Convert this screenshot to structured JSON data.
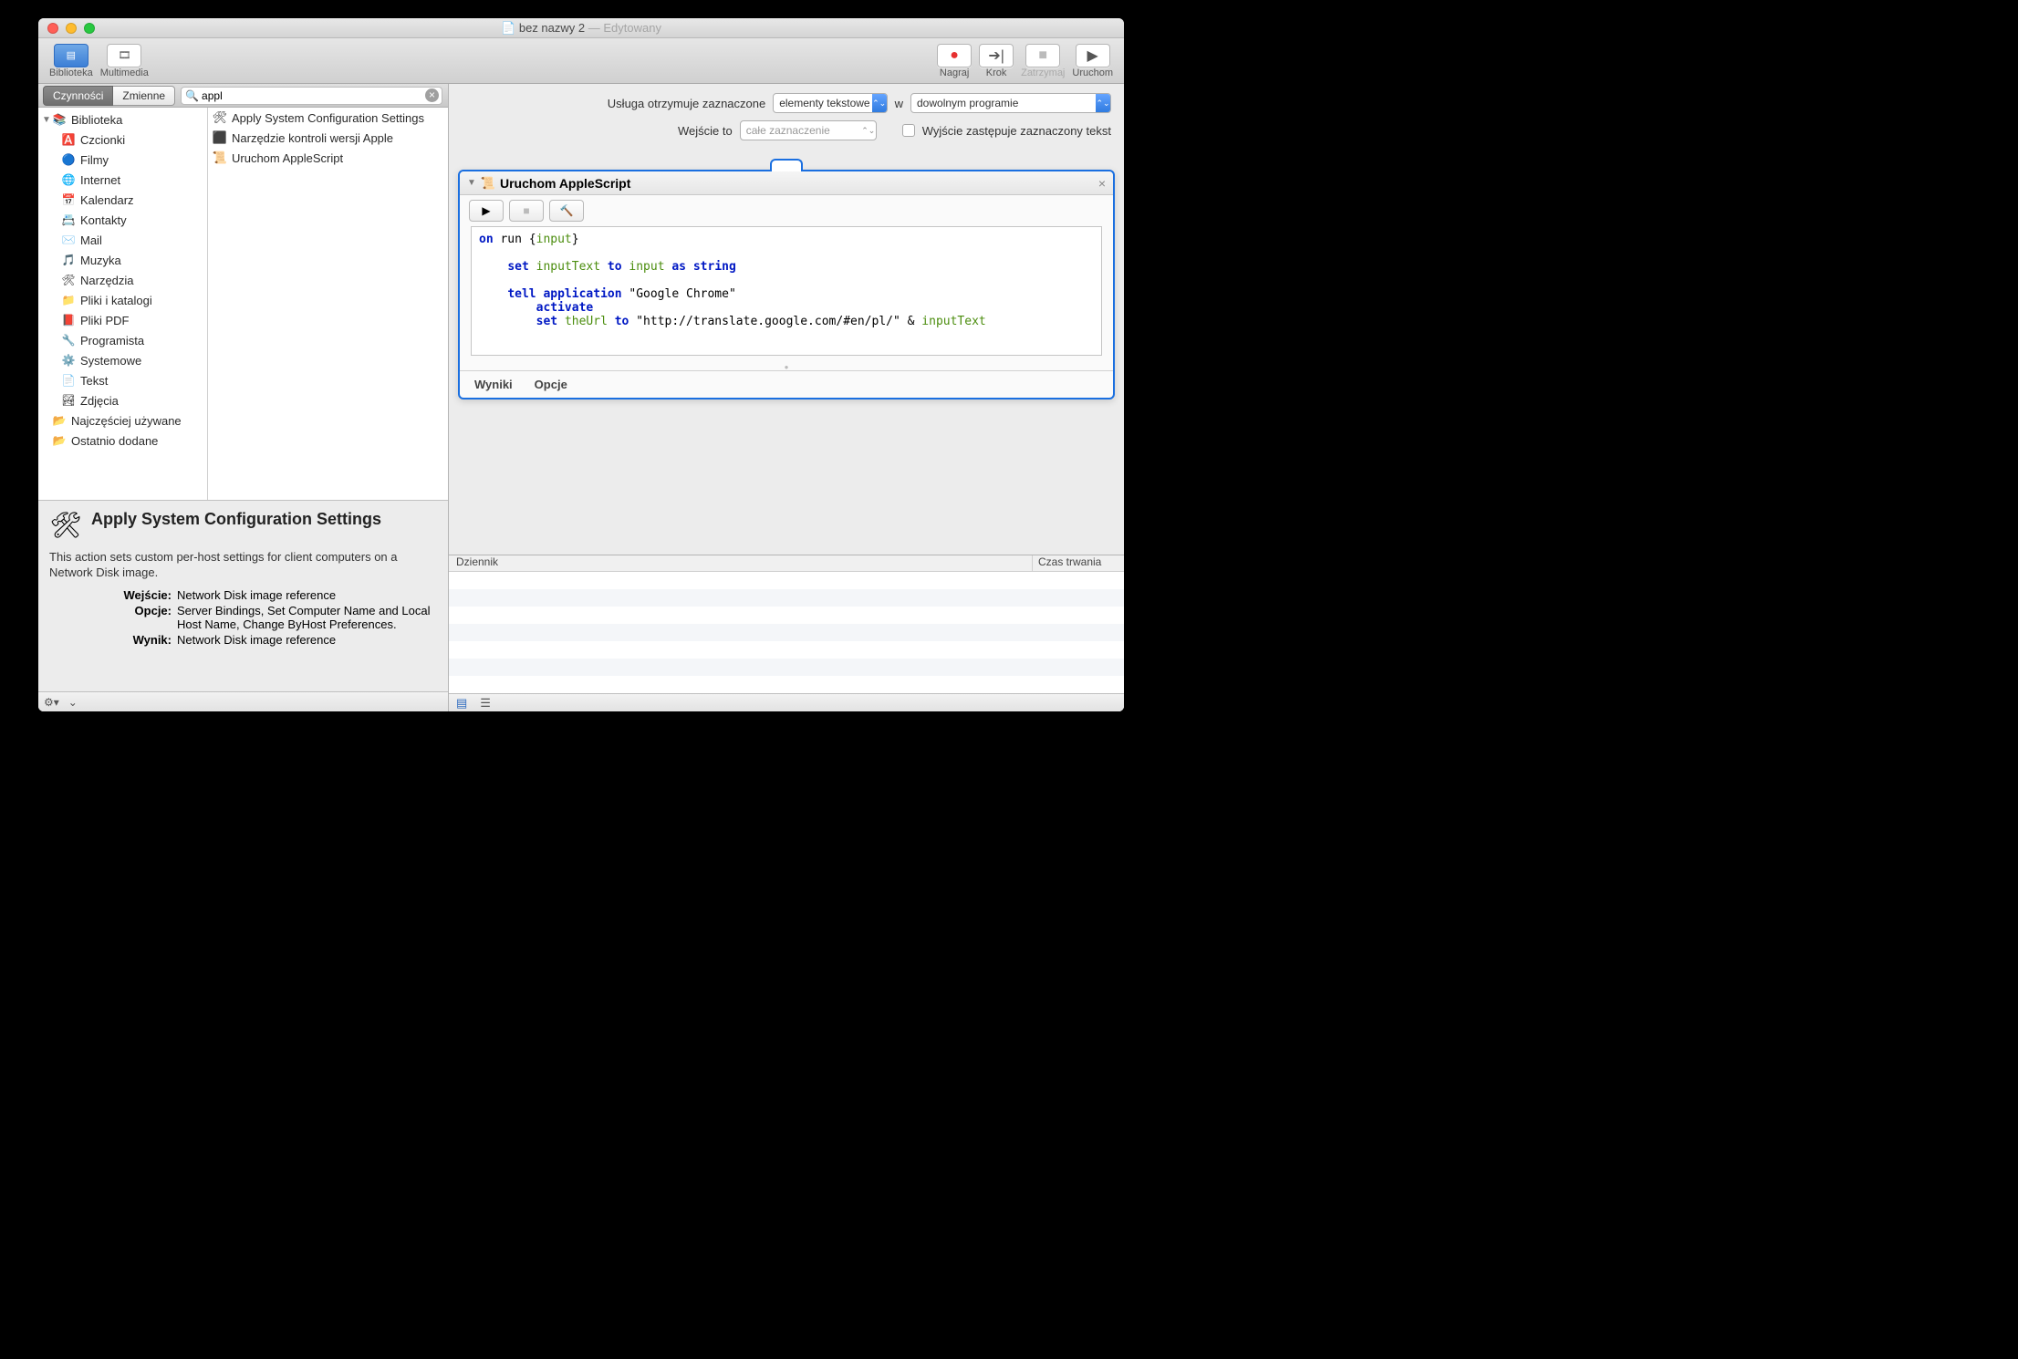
{
  "window": {
    "doc_icon": "📄",
    "title_main": "bez nazwy 2",
    "title_sep": " — ",
    "title_status": "Edytowany"
  },
  "toolbar": {
    "left": [
      {
        "name": "biblioteka",
        "label": "Biblioteka",
        "icon": "▤",
        "selected": true
      },
      {
        "name": "multimedia",
        "label": "Multimedia",
        "icon": "🎞",
        "selected": false
      }
    ],
    "right": [
      {
        "name": "nagraj",
        "label": "Nagraj",
        "icon": "●",
        "color": "#e63030"
      },
      {
        "name": "krok",
        "label": "Krok",
        "icon": "➔|",
        "color": "#555"
      },
      {
        "name": "zatrzymaj",
        "label": "Zatrzymaj",
        "icon": "■",
        "color": "#bbb",
        "disabled": true
      },
      {
        "name": "uruchom",
        "label": "Uruchom",
        "icon": "▶",
        "color": "#555"
      }
    ]
  },
  "library": {
    "tabs": {
      "actions": "Czynności",
      "variables": "Zmienne"
    },
    "search_value": "appl",
    "tree_root": "Biblioteka",
    "categories": [
      {
        "label": "Czcionki",
        "icon": "🅰️"
      },
      {
        "label": "Filmy",
        "icon": "🔵"
      },
      {
        "label": "Internet",
        "icon": "🌐"
      },
      {
        "label": "Kalendarz",
        "icon": "📅"
      },
      {
        "label": "Kontakty",
        "icon": "📇"
      },
      {
        "label": "Mail",
        "icon": "✉️"
      },
      {
        "label": "Muzyka",
        "icon": "🎵"
      },
      {
        "label": "Narzędzia",
        "icon": "🛠"
      },
      {
        "label": "Pliki i katalogi",
        "icon": "📁"
      },
      {
        "label": "Pliki PDF",
        "icon": "📕"
      },
      {
        "label": "Programista",
        "icon": "🔧"
      },
      {
        "label": "Systemowe",
        "icon": "⚙️"
      },
      {
        "label": "Tekst",
        "icon": "📄"
      },
      {
        "label": "Zdjęcia",
        "icon": "🏞"
      }
    ],
    "smart": [
      {
        "label": "Najczęściej używane",
        "icon": "📂"
      },
      {
        "label": "Ostatnio dodane",
        "icon": "📂"
      }
    ],
    "results": [
      {
        "label": "Apply System Configuration Settings",
        "icon": "🛠"
      },
      {
        "label": "Narzędzie kontroli wersji Apple",
        "icon": "⬛"
      },
      {
        "label": "Uruchom AppleScript",
        "icon": "📜"
      }
    ]
  },
  "info": {
    "title": "Apply System Configuration Settings",
    "desc": "This action sets custom per-host settings for client computers on a Network Disk image.",
    "rows": [
      {
        "label": "Wejście:",
        "value": "Network Disk image reference"
      },
      {
        "label": "Opcje:",
        "value": "Server Bindings, Set Computer Name and Local Host Name, Change ByHost Preferences."
      },
      {
        "label": "Wynik:",
        "value": "Network Disk image reference"
      }
    ]
  },
  "config": {
    "row1_label": "Usługa otrzymuje zaznaczone",
    "type_select": "elementy tekstowe",
    "in_label": "w",
    "app_select": "dowolnym programie",
    "row2_label": "Wejście to",
    "input_select": "całe zaznaczenie",
    "output_check_label": "Wyjście zastępuje zaznaczony tekst"
  },
  "action": {
    "title": "Uruchom AppleScript",
    "code_lines": [
      {
        "chunks": [
          {
            "t": "on",
            "c": "kw"
          },
          {
            "t": " run {",
            "c": ""
          },
          {
            "t": "input",
            "c": "var"
          },
          {
            "t": "}",
            "c": ""
          }
        ]
      },
      {
        "chunks": []
      },
      {
        "chunks": [
          {
            "t": "\t",
            "c": ""
          },
          {
            "t": "set",
            "c": "kw"
          },
          {
            "t": " ",
            "c": ""
          },
          {
            "t": "inputText",
            "c": "var"
          },
          {
            "t": " ",
            "c": ""
          },
          {
            "t": "to",
            "c": "kw"
          },
          {
            "t": " ",
            "c": ""
          },
          {
            "t": "input",
            "c": "var"
          },
          {
            "t": " ",
            "c": ""
          },
          {
            "t": "as",
            "c": "kw"
          },
          {
            "t": " ",
            "c": ""
          },
          {
            "t": "string",
            "c": "op"
          }
        ]
      },
      {
        "chunks": []
      },
      {
        "chunks": [
          {
            "t": "\t",
            "c": ""
          },
          {
            "t": "tell",
            "c": "kw"
          },
          {
            "t": " ",
            "c": ""
          },
          {
            "t": "application",
            "c": "op"
          },
          {
            "t": " \"Google Chrome\"",
            "c": ""
          }
        ]
      },
      {
        "chunks": [
          {
            "t": "\t\t",
            "c": ""
          },
          {
            "t": "activate",
            "c": "op"
          }
        ]
      },
      {
        "chunks": [
          {
            "t": "\t\t",
            "c": ""
          },
          {
            "t": "set",
            "c": "kw"
          },
          {
            "t": " ",
            "c": ""
          },
          {
            "t": "theUrl",
            "c": "var"
          },
          {
            "t": " ",
            "c": ""
          },
          {
            "t": "to",
            "c": "kw"
          },
          {
            "t": " \"http://translate.google.com/#en/pl/\" & ",
            "c": ""
          },
          {
            "t": "inputText",
            "c": "var"
          }
        ]
      }
    ],
    "footer_tabs": [
      "Wyniki",
      "Opcje"
    ]
  },
  "log": {
    "col1": "Dziennik",
    "col2": "Czas trwania"
  }
}
